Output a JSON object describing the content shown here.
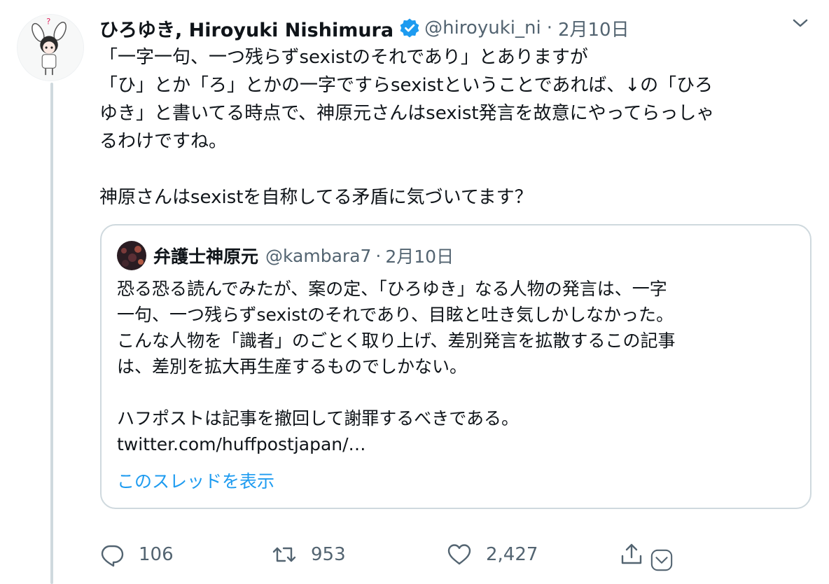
{
  "author": {
    "name": "ひろゆき, Hiroyuki Nishimura",
    "handle": "@hiroyuki_ni",
    "date": "2月10日"
  },
  "tweet": {
    "lines": [
      "「一字一句、一つ残らずsexistのそれであり」とありますが",
      "「ひ」とか「ろ」とかの一字ですらsexistということであれば、↓の「ひろ",
      "ゆき」と書いてる時点で、神原元さんはsexist発言を故意にやってらっしゃ",
      "るわけですね。",
      "",
      "神原さんはsexistを自称してる矛盾に気づいてます？"
    ]
  },
  "quoted": {
    "name": "弁護士神原元",
    "handle": "@kambara7",
    "date": "2月10日",
    "lines": [
      "恐る恐る読んでみたが、案の定、「ひろゆき」なる人物の発言は、一字",
      "一句、一つ残らずsexistのそれであり、目眩と吐き気しかしなかった。",
      "こんな人物を「識者」のごとく取り上げ、差別発言を拡散するこの記事",
      "は、差別を拡大再生産するものでしかない。",
      "",
      "ハフポストは記事を撤回して謝罪するべきである。",
      "twitter.com/huffpostjapan/…"
    ],
    "show_thread": "このスレッドを表示"
  },
  "actions": {
    "reply_count": "106",
    "retweet_count": "953",
    "like_count": "2,427"
  },
  "icons": {
    "caret": "chevron-down-icon",
    "verified": "verified-badge-icon",
    "reply": "reply-icon",
    "retweet": "retweet-icon",
    "like": "heart-icon",
    "share": "share-icon",
    "dm": "dm-icon"
  },
  "colors": {
    "text": "#0f1419",
    "secondary": "#536471",
    "link": "#1d9bf0",
    "border": "#cfd9de"
  }
}
